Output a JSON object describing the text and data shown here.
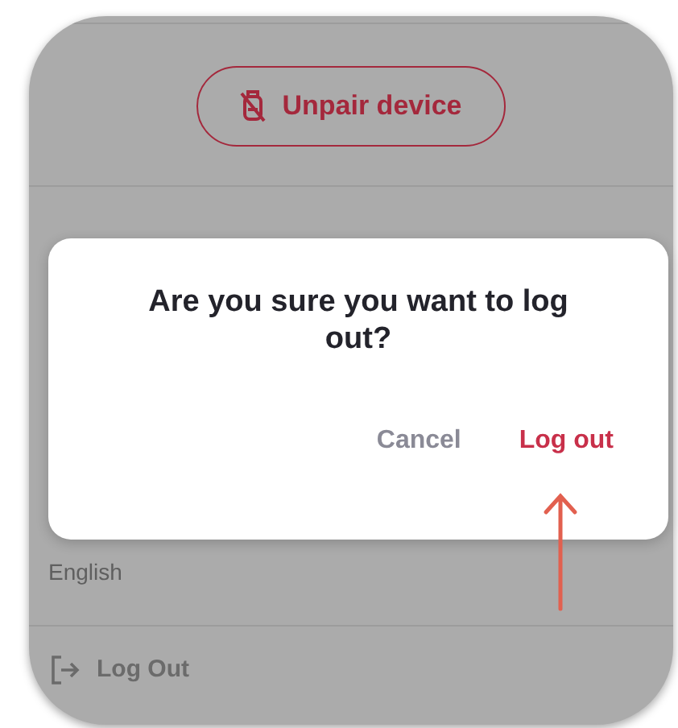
{
  "settings": {
    "unpair_button": {
      "label": "Unpair device"
    },
    "language_value": "English",
    "logout_row": {
      "label": "Log Out"
    }
  },
  "dialog": {
    "title": "Are you sure you want to log out?",
    "buttons": [
      {
        "label": "Cancel",
        "kind": "secondary"
      },
      {
        "label": "Log out",
        "kind": "primary"
      }
    ]
  }
}
